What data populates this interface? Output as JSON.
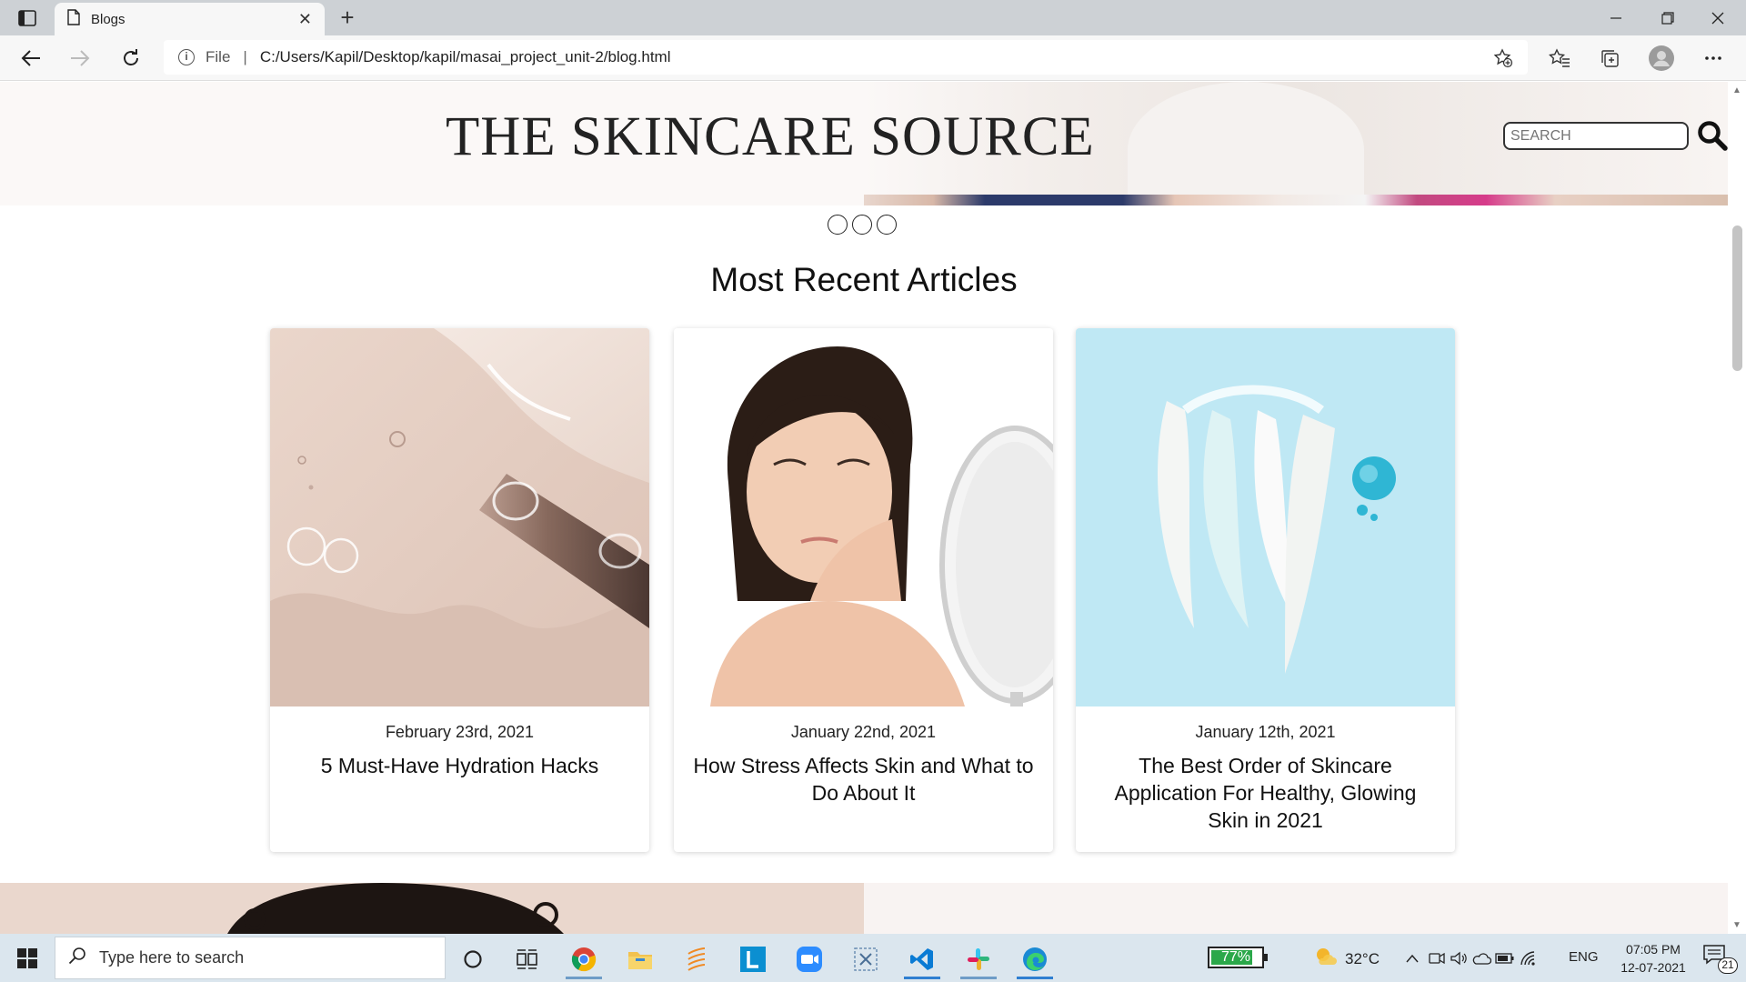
{
  "browser": {
    "tab_title": "Blogs",
    "tab_close": "✕",
    "new_tab": "+",
    "address": {
      "scheme_label": "File",
      "separator": "|",
      "url": "C:/Users/Kapil/Desktop/kapil/masai_project_unit-2/blog.html"
    }
  },
  "page": {
    "site_title": "THE SKINCARE SOURCE",
    "search_placeholder": "SEARCH",
    "section_title": "Most Recent Articles",
    "carousel_dot_count": 3,
    "articles": [
      {
        "date": "February 23rd, 2021",
        "title": "5 Must-Have Hydration Hacks"
      },
      {
        "date": "January 22nd, 2021",
        "title": "How Stress Affects Skin and What to Do About It"
      },
      {
        "date": "January 12th, 2021",
        "title": "The Best Order of Skincare Application For Healthy, Glowing Skin in 2021"
      }
    ]
  },
  "taskbar": {
    "search_placeholder": "Type here to search",
    "battery_level": "77%",
    "temperature": "32°C",
    "language": "ENG",
    "time": "07:05 PM",
    "date": "12-07-2021",
    "notification_count": "21"
  }
}
